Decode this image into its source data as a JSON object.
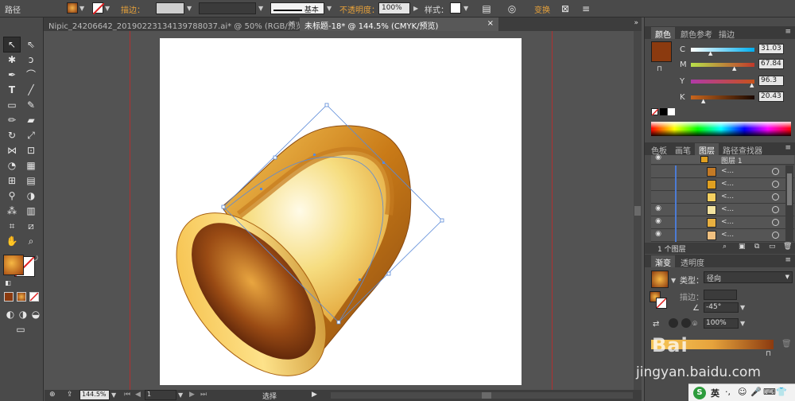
{
  "control_bar": {
    "object_type": "路径",
    "stroke_label": "描边：",
    "stroke_style": "基本",
    "opacity_label": "不透明度：",
    "opacity_value": "100%",
    "style_label": "样式：",
    "transform_label": "变换",
    "fill_color": "#b5651d",
    "accent": "#e8a23a"
  },
  "doc_tabs": [
    {
      "label": "Nipic_24206642_20190223134139788037.ai* @ 50% (RGB/预览)"
    },
    {
      "label": "未标题-18* @ 144.5% (CMYK/预览)"
    }
  ],
  "status": {
    "zoom": "144.5%",
    "page": "1",
    "tool": "选择"
  },
  "color_panel": {
    "tabs": [
      "颜色",
      "颜色参考",
      "描边"
    ],
    "swatch": "#8b3a0f",
    "channels": [
      {
        "name": "C",
        "value": "31.03",
        "fraction": 0.31,
        "gradient": "linear-gradient(to right, #ffffff, #00aeef)"
      },
      {
        "name": "M",
        "value": "67.84",
        "fraction": 0.68,
        "gradient": "linear-gradient(to right, #b8e04a, #c0392b)"
      },
      {
        "name": "Y",
        "value": "96.3",
        "fraction": 0.96,
        "gradient": "linear-gradient(to right, #b03aa8, #c7521b)"
      },
      {
        "name": "K",
        "value": "20.43",
        "fraction": 0.2,
        "gradient": "linear-gradient(to right, #c8651d, #1a0800)"
      }
    ]
  },
  "layers_panel": {
    "tabs": [
      "色板",
      "画笔",
      "图层",
      "路径查找器"
    ],
    "top_layer": "图层 1",
    "rows": [
      {
        "label": "<...",
        "thumb": "#c47a25"
      },
      {
        "label": "<...",
        "thumb": "#e0a020"
      },
      {
        "label": "<...",
        "thumb": "#f5d060"
      },
      {
        "label": "<...",
        "thumb": "#f3e3a0"
      },
      {
        "label": "<...",
        "thumb": "#e8b040"
      },
      {
        "label": "<...",
        "thumb": "#f0c080"
      }
    ],
    "footer": "1 个图层"
  },
  "gradient_panel": {
    "tabs": [
      "渐变",
      "透明度"
    ],
    "type_label": "类型：",
    "type_value": "径向",
    "stroke_label": "描边：",
    "angle": "-45°",
    "aspect": "100%"
  },
  "watermark": {
    "logo": "Bai",
    "text": "jingyan.baidu.com"
  },
  "taskbar": {
    "ime": "英"
  }
}
